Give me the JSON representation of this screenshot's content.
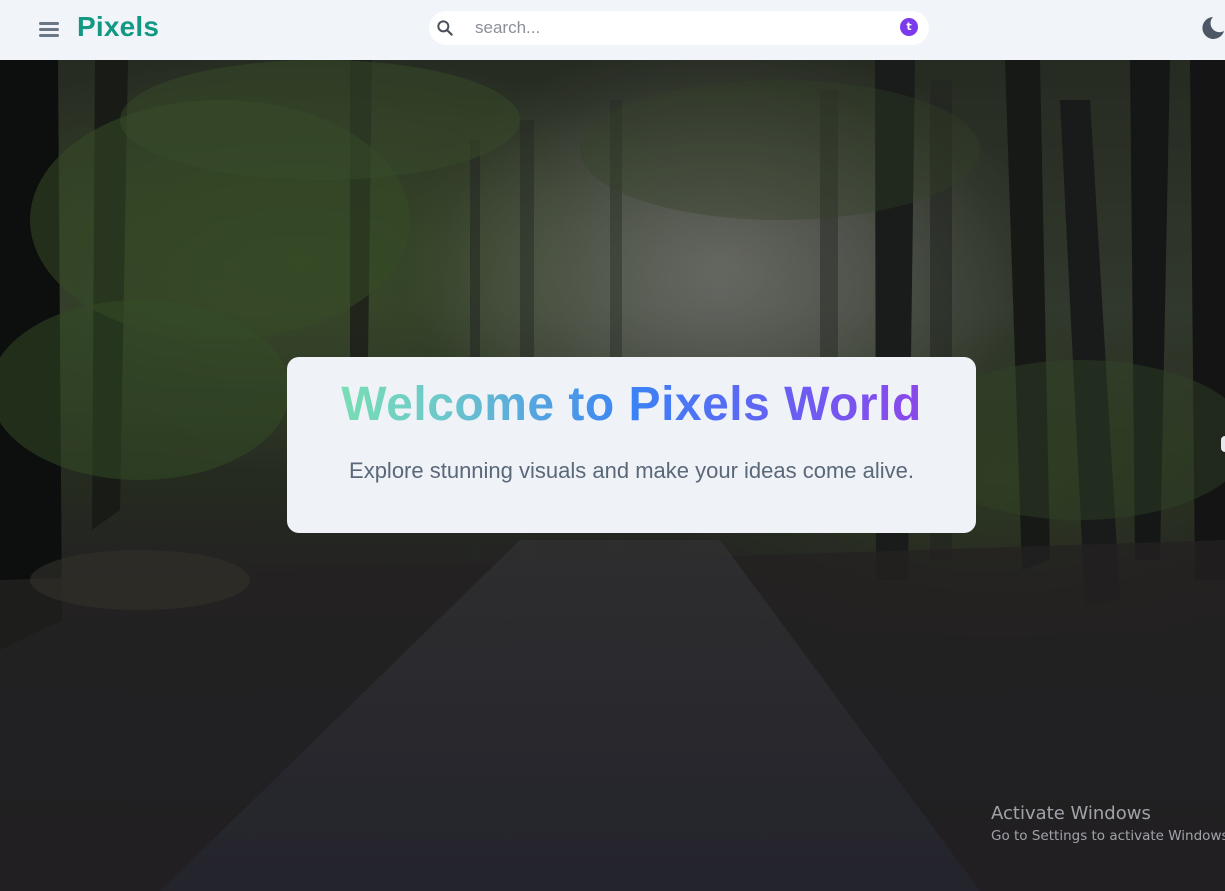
{
  "header": {
    "logo": "Pixels",
    "search": {
      "placeholder": "search...",
      "value": "",
      "extension_badge": "t"
    },
    "icons": {
      "menu": "hamburger-menu-icon",
      "search": "magnifier-icon",
      "theme": "moon-icon"
    }
  },
  "hero": {
    "background": "forest-path-photo",
    "title": "Welcome to Pixels World",
    "subtitle": "Explore stunning visuals and make your ideas come alive."
  },
  "watermark": {
    "title": "Activate Windows",
    "subtitle": "Go to Settings to activate Windows."
  },
  "colors": {
    "header_bg": "#f1f4f8",
    "logo": "#139983",
    "card_bg": "#eff2f7",
    "subtitle": "#5a6879",
    "badge": "#7c3aed",
    "title_gradient": [
      "#7ee8a8",
      "#3b82f6",
      "#9b3ee8"
    ]
  }
}
